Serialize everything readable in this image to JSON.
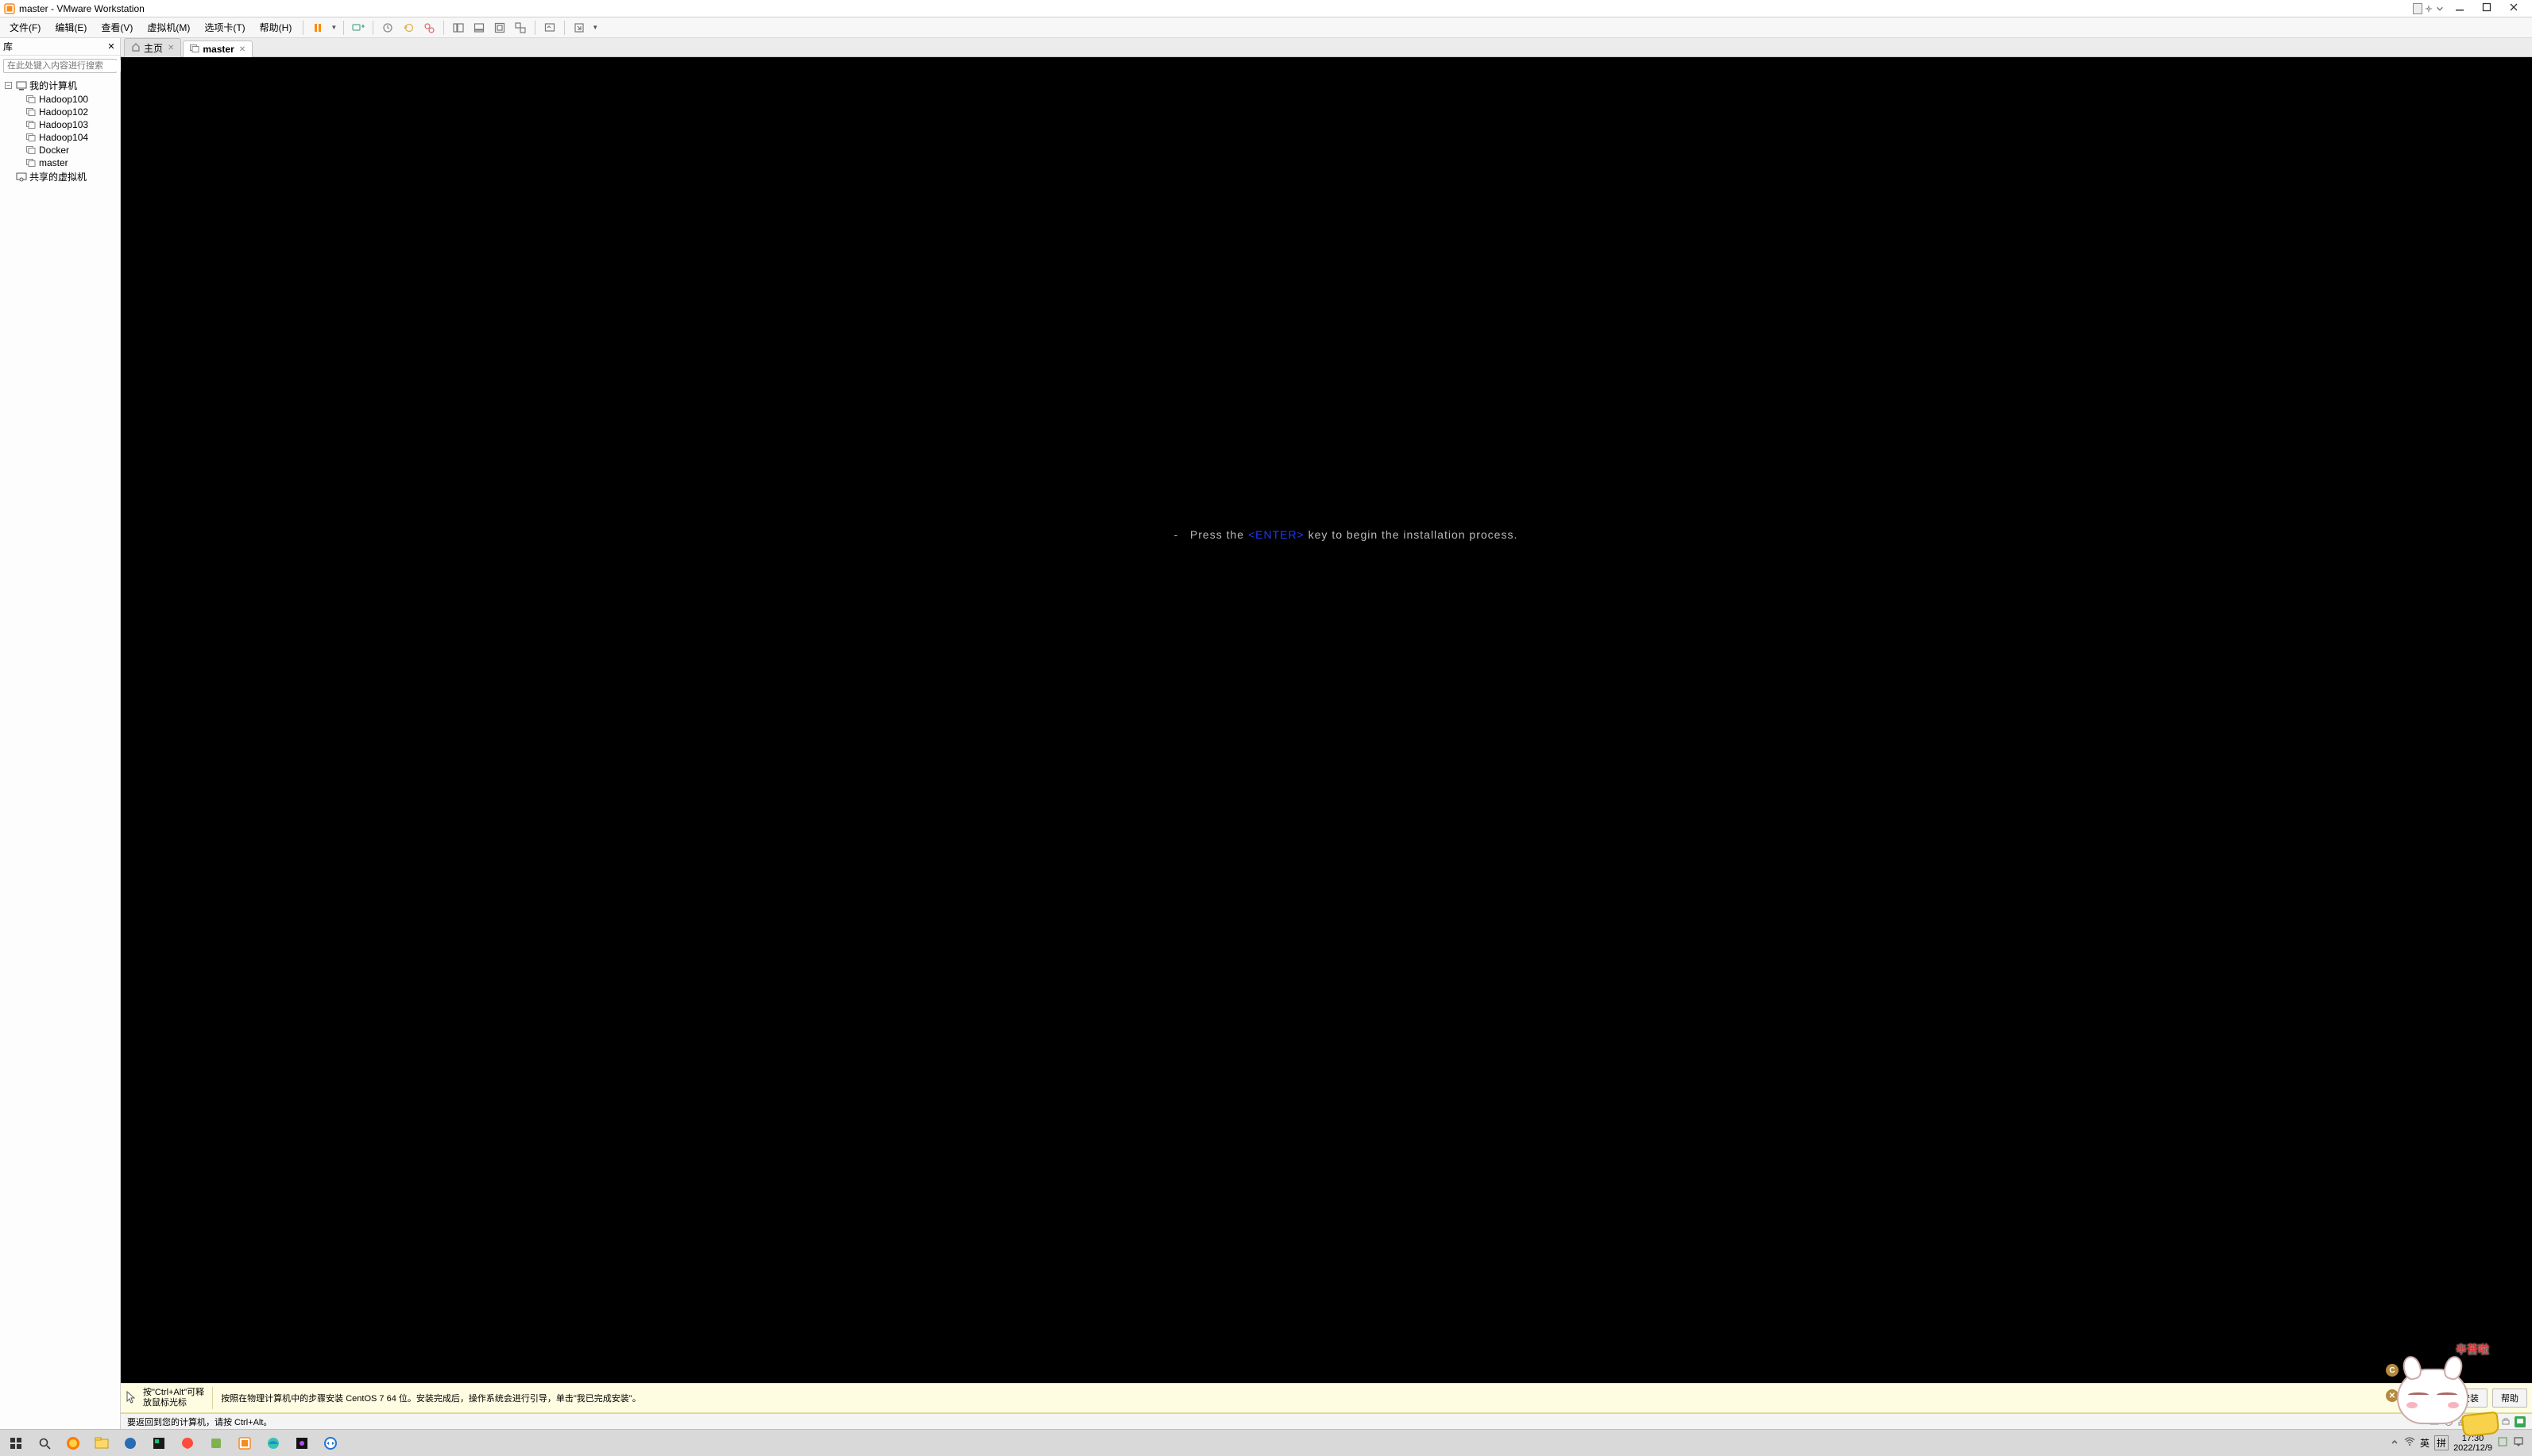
{
  "title": "master - VMware Workstation",
  "menu": {
    "file": "文件(F)",
    "edit": "编辑(E)",
    "view": "查看(V)",
    "vm": "虚拟机(M)",
    "tabs": "选项卡(T)",
    "help": "帮助(H)"
  },
  "library": {
    "header": "库",
    "search_placeholder": "在此处键入内容进行搜索",
    "root": "我的计算机",
    "items": [
      "Hadoop100",
      "Hadoop102",
      "Hadoop103",
      "Hadoop104",
      "Docker",
      "master"
    ],
    "shared": "共享的虚拟机"
  },
  "tabs": {
    "home": "主页",
    "active": "master"
  },
  "vm": {
    "prefix": "-   Press the ",
    "enter": "<ENTER>",
    "suffix": " key to begin the installation process."
  },
  "infobar": {
    "hint_line1": "按\"Ctrl+Alt\"可释",
    "hint_line2": "放鼠标光标",
    "message": "按照在物理计算机中的步骤安装 CentOS 7 64 位。安装完成后，操作系统会进行引导，单击\"我已完成安装\"。",
    "btn_done": "我已完成安装",
    "btn_help": "帮助"
  },
  "statusbar": {
    "text": "要返回到您的计算机，请按 Ctrl+Alt。"
  },
  "mascot": {
    "label": "辛苦啦"
  },
  "systray": {
    "ime1": "英",
    "ime2": "拼",
    "time": "17:30",
    "date": "2022/12/9"
  }
}
